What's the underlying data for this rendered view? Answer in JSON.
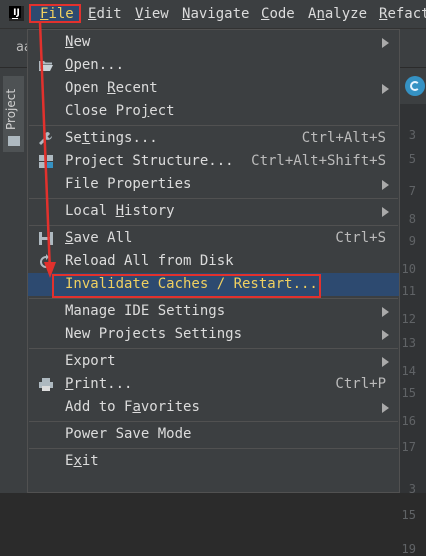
{
  "menubar": {
    "logo": "IJ",
    "items": [
      {
        "label": "File",
        "accel": "F",
        "rest": "ile"
      },
      {
        "label": "Edit",
        "accel": "E",
        "rest": "dit"
      },
      {
        "label": "View",
        "accel": "V",
        "rest": "iew"
      },
      {
        "label": "Navigate",
        "accel": "N",
        "rest": "avigate"
      },
      {
        "label": "Code",
        "accel": "C",
        "rest": "ode"
      },
      {
        "label": "Analyze",
        "pre": "A",
        "accel": "n",
        "rest": "alyze"
      },
      {
        "label": "Refactor",
        "accel": "R",
        "rest": "efact"
      }
    ]
  },
  "ide": {
    "project_tab": "aa",
    "side_tool": "Project",
    "line_numbers": [
      "3",
      "5",
      "7",
      "8",
      "9",
      "10",
      "11",
      "12",
      "13",
      "14",
      "15",
      "16",
      "17",
      "3",
      "15",
      "19"
    ]
  },
  "file_menu": {
    "items": [
      {
        "pre": "",
        "accel": "N",
        "post": "ew",
        "shortcut": "",
        "submenu": true
      },
      {
        "pre": "",
        "accel": "O",
        "post": "pen...",
        "shortcut": "",
        "submenu": false
      },
      {
        "pre": "Open ",
        "accel": "R",
        "post": "ecent",
        "shortcut": "",
        "submenu": true
      },
      {
        "pre": "Close Pro",
        "accel": "j",
        "post": "ect",
        "shortcut": "",
        "submenu": false
      },
      {
        "pre": "Se",
        "accel": "t",
        "post": "tings...",
        "shortcut": "Ctrl+Alt+S",
        "submenu": false
      },
      {
        "pre": "Project Structure...",
        "accel": "",
        "post": "",
        "shortcut": "Ctrl+Alt+Shift+S",
        "submenu": false
      },
      {
        "pre": "File Properties",
        "accel": "",
        "post": "",
        "shortcut": "",
        "submenu": true
      },
      {
        "pre": "Local ",
        "accel": "H",
        "post": "istory",
        "shortcut": "",
        "submenu": true
      },
      {
        "pre": "",
        "accel": "S",
        "post": "ave All",
        "shortcut": "Ctrl+S",
        "submenu": false
      },
      {
        "pre": "Reload All from Disk",
        "accel": "",
        "post": "",
        "shortcut": "",
        "submenu": false
      },
      {
        "pre": "Invalidate Caches / Restart...",
        "accel": "",
        "post": "",
        "shortcut": "",
        "submenu": false
      },
      {
        "pre": "Manage IDE Settings",
        "accel": "",
        "post": "",
        "shortcut": "",
        "submenu": true
      },
      {
        "pre": "New Projects Settings",
        "accel": "",
        "post": "",
        "shortcut": "",
        "submenu": true
      },
      {
        "pre": "Export",
        "accel": "",
        "post": "",
        "shortcut": "",
        "submenu": true
      },
      {
        "pre": "",
        "accel": "P",
        "post": "rint...",
        "shortcut": "Ctrl+P",
        "submenu": false
      },
      {
        "pre": "Add to F",
        "accel": "a",
        "post": "vorites",
        "shortcut": "",
        "submenu": true
      },
      {
        "pre": "Power Save Mode",
        "accel": "",
        "post": "",
        "shortcut": "",
        "submenu": false
      },
      {
        "pre": "E",
        "accel": "x",
        "post": "it",
        "shortcut": "",
        "submenu": false
      }
    ]
  },
  "colors": {
    "highlight_outline": "#e2312d",
    "selected_bg": "#2d4a70",
    "selected_text": "#f0d060"
  }
}
